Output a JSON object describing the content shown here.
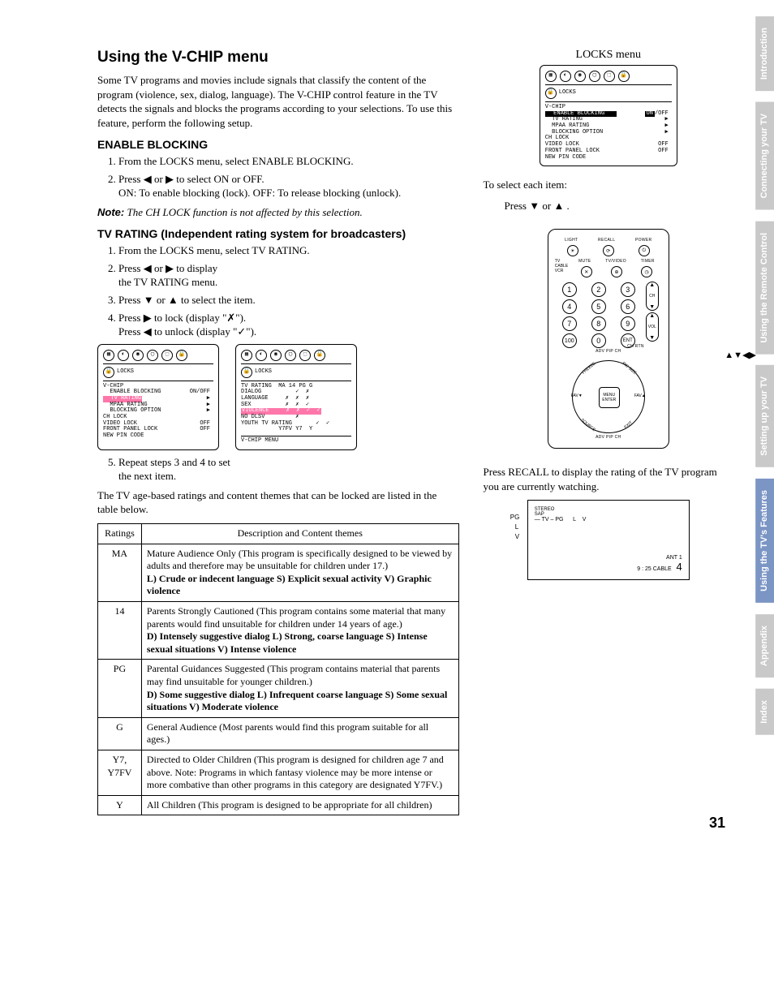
{
  "headings": {
    "h1": "Using the V-CHIP menu",
    "enable": "ENABLE BLOCKING",
    "tvrating": "TV RATING (Independent rating system for broadcasters)"
  },
  "intro": "Some TV programs and movies include signals that classify the content of the program (violence, sex, dialog, language). The V-CHIP control feature in the TV detects the signals and blocks the programs according to your selections. To use this feature, perform the following setup.",
  "enable_steps": {
    "s1": "From the LOCKS menu, select ENABLE BLOCKING.",
    "s2a": "Press ◀ or ▶ to select ON or OFF.",
    "s2b": "ON: To enable blocking (lock). OFF: To release blocking (unlock)."
  },
  "note": {
    "label": "Note:",
    "text": "The CH LOCK function is not affected by this selection."
  },
  "tvrating_steps": {
    "s1": "From the LOCKS menu, select TV RATING.",
    "s2a": "Press ◀ or ▶ to display",
    "s2b": "the TV RATING menu.",
    "s3": "Press ▼ or ▲ to select the item.",
    "s4a": "Press ▶ to lock (display \"✗\").",
    "s4b": "Press ◀ to unlock (display \"✓\").",
    "s5": "Repeat steps 3 and 4 to set",
    "s5b": "the next item."
  },
  "table_intro": "The TV age-based ratings and content themes that can be locked are listed in the table below.",
  "table_headers": {
    "c1": "Ratings",
    "c2": "Description and Content themes"
  },
  "table_rows": [
    {
      "rating": "MA",
      "plain": "Mature Audience Only (This program is specifically designed to be viewed by adults and therefore may be unsuitable for children under 17.)",
      "bold": "L) Crude or indecent language  S) Explicit sexual activity  V) Graphic violence"
    },
    {
      "rating": "14",
      "plain": "Parents Strongly Cautioned (This program contains some material that many parents would find unsuitable for children under 14 years of age.)",
      "bold": "D) Intensely suggestive dialog  L) Strong, coarse language  S) Intense sexual situations  V) Intense violence"
    },
    {
      "rating": "PG",
      "plain": "Parental Guidances Suggested (This program contains material that parents may find unsuitable for younger children.)",
      "bold": "D) Some suggestive dialog  L) Infrequent coarse language  S) Some sexual situations  V) Moderate violence"
    },
    {
      "rating": "G",
      "plain": "General Audience (Most parents would find this program suitable for all ages.)",
      "bold": ""
    },
    {
      "rating": "Y7, Y7FV",
      "plain": "Directed to Older Children (This program is designed for children age 7 and above. Note: Programs in which fantasy violence may be more intense or more combative than other programs in this category are designated Y7FV.)",
      "bold": ""
    },
    {
      "rating": "Y",
      "plain": "All Children (This program is designed to be appropriate for all children)",
      "bold": ""
    }
  ],
  "locks_menu": {
    "caption": "LOCKS menu",
    "title": "LOCKS",
    "section": "V-CHIP",
    "rows": [
      [
        "ENABLE BLOCKING",
        "ON/OFF"
      ],
      [
        "TV RATING",
        "▶"
      ],
      [
        "MPAA RATING",
        "▶"
      ],
      [
        "BLOCKING OPTION",
        "▶"
      ],
      [
        "CH LOCK",
        ""
      ],
      [
        "VIDEO LOCK",
        "OFF"
      ],
      [
        "FRONT PANEL LOCK",
        "OFF"
      ],
      [
        "NEW PIN CODE",
        ""
      ]
    ],
    "highlight_row_top": "ENABLE BLOCKING",
    "highlight_on": "ON",
    "highlight_row_left": "TV RATING"
  },
  "tvrating_menu": {
    "title": "LOCKS",
    "header": "TV RATING  MA 14 PG G",
    "rows": [
      "DIALOG          ✓  ✗",
      "LANGUAGE     ✗  ✗  ✗",
      "SEX          ✗  ✗  ✓",
      "VIOLENCE     ✗  ✗  ✓  ✓",
      "NO DLSV         ✗",
      "YOUTH TV RATING       ✓  ✓",
      "           Y7FV Y7  Y"
    ],
    "footer": "V-CHIP MENU",
    "highlight": "VIOLENCE"
  },
  "right_text": {
    "select_item": "To select each item:",
    "press_arrows": "Press ▼ or ▲ .",
    "recall": "Press RECALL to display the rating of the TV program you are currently watching.",
    "arrow_keys": "▲▼◀▶"
  },
  "remote": {
    "labels_top": [
      "LIGHT",
      "RECALL",
      "POWER"
    ],
    "sw": [
      "TV",
      "CABLE",
      "VCR"
    ],
    "labels2": [
      "MUTE",
      "TV/VIDEO",
      "TIMER"
    ],
    "nums": [
      "1",
      "2",
      "3",
      "4",
      "5",
      "6",
      "7",
      "8",
      "9",
      "100",
      "0",
      "ENT"
    ],
    "ch": "CH",
    "vol": "VOL",
    "chrtn": "CH RTN",
    "adv": "ADV PIP CH",
    "fav_l": "FAV▼",
    "fav_r": "FAV▲",
    "menu": "MENU\nENTER",
    "bl": "SOURCE",
    "br": "EXIT",
    "tl": "FREEZE",
    "tr": "PIC SIZE"
  },
  "osd": {
    "lines": [
      "STEREO",
      "SAP"
    ],
    "pg": "PG",
    "tv_pg": "TV – PG",
    "l1": "L",
    "v1": "V",
    "l2": "L",
    "v2": "V",
    "ant": "ANT  1",
    "time": "9 : 25   CABLE",
    "ch": "4"
  },
  "tabs": [
    "Introduction",
    "Connecting your TV",
    "Using the Remote Control",
    "Setting up your TV",
    "Using the TV's Features",
    "Appendix",
    "Index"
  ],
  "active_tab": 4,
  "page_number": "31"
}
